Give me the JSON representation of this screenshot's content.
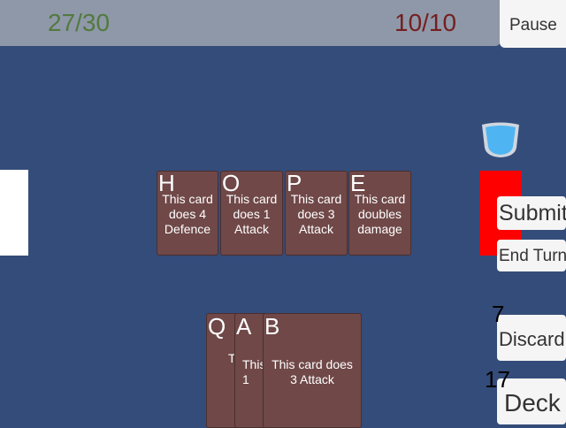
{
  "header": {
    "player_hp": "27/30",
    "enemy_hp": "10/10",
    "pause_label": "Pause"
  },
  "colors": {
    "background": "#344c79",
    "card": "#704848",
    "player_hp": "#527a3f",
    "enemy_hp": "#741f1f",
    "enemy_block": "#ff0000",
    "shield": "#4fb5f2"
  },
  "icons": {
    "enemy_intent": "shield-icon"
  },
  "played_cards": [
    {
      "letter": "H",
      "text": "This card does 4 Defence"
    },
    {
      "letter": "O",
      "text": "This card does 1 Attack"
    },
    {
      "letter": "P",
      "text": "This card does 3 Attack"
    },
    {
      "letter": "E",
      "text": "This card doubles damage"
    }
  ],
  "hand_cards": [
    {
      "letter": "Q",
      "text": "T"
    },
    {
      "letter": "A",
      "text": "This 1"
    },
    {
      "letter": "B",
      "text": "This card does 3 Attack"
    }
  ],
  "actions": {
    "submit_label": "Submit",
    "end_turn_label": "End Turn",
    "discard_label": "Discard",
    "discard_count": "7",
    "deck_label": "Deck",
    "deck_count": "17"
  }
}
